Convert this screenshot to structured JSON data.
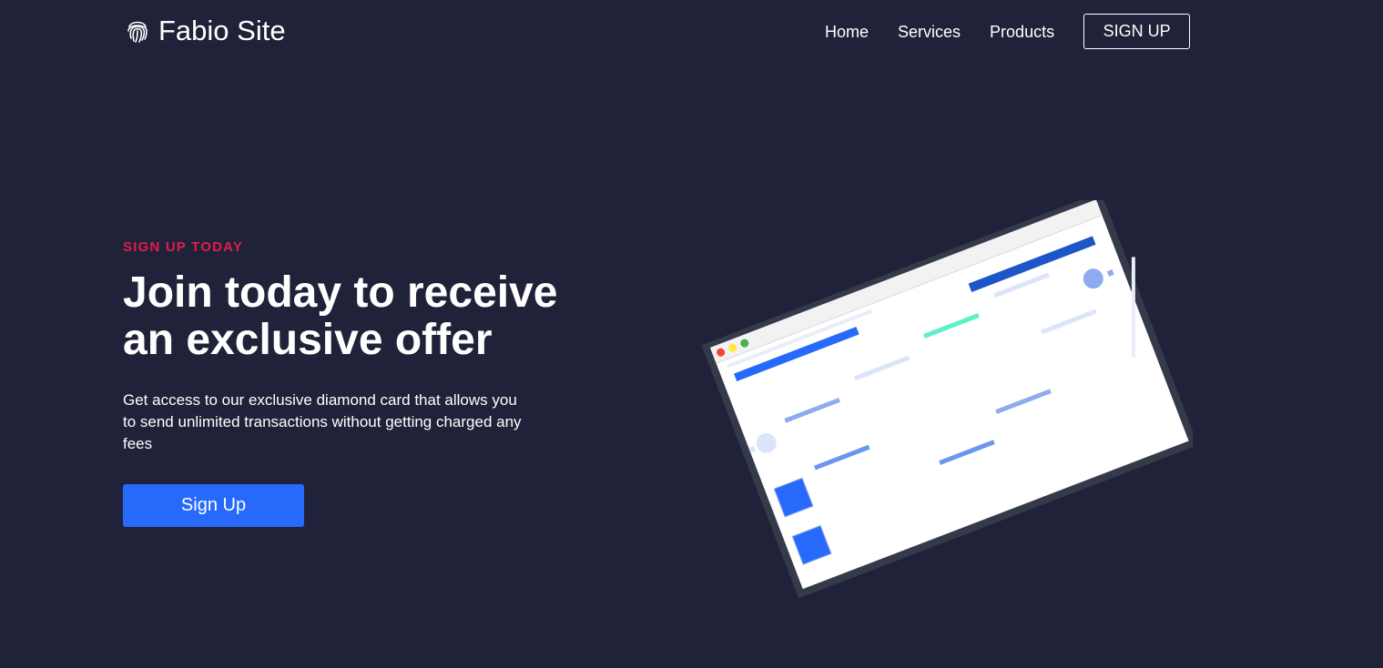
{
  "brand": {
    "name": "Fabio Site",
    "logo_icon": "fingerprint-icon"
  },
  "nav": {
    "links": [
      "Home",
      "Services",
      "Products"
    ],
    "signup_label": "SIGN UP"
  },
  "hero": {
    "eyebrow": "SIGN UP TODAY",
    "headline": "Join today to receive an exclusive offer",
    "description": "Get access to our exclusive diamond card that allows you to send unlimited transactions without getting charged any fees",
    "cta_label": "Sign Up"
  },
  "colors": {
    "background": "#1f2238",
    "accent_red": "#e61a4a",
    "primary_blue": "#276afb",
    "text": "#ffffff"
  }
}
